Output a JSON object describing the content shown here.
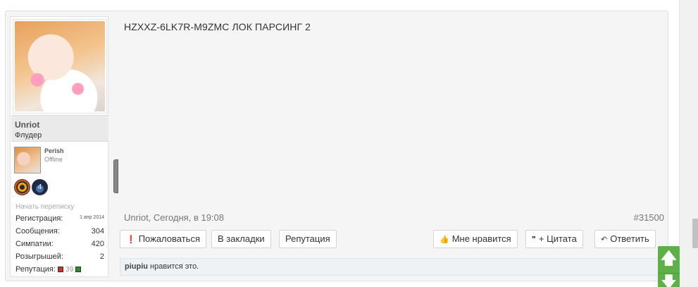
{
  "post": {
    "message": "HZXXZ-6LK7R-M9ZMC ЛОК ПАРСИНГ 2",
    "author_meta": "Unriot, Сегодня, в 19:08",
    "post_id": "#31500"
  },
  "user": {
    "name": "Unriot",
    "title": "Флудер",
    "related_user": {
      "name": "Perish",
      "status": "Offline"
    },
    "pm_link": "Начать переписку",
    "stats": {
      "registration_label": "Регистрация:",
      "registration_value": "1 апр 2014",
      "messages_label": "Сообщения:",
      "messages_value": "304",
      "likes_label": "Симпатии:",
      "likes_value": "420",
      "giveaways_label": "Розыгрышей:",
      "giveaways_value": "2",
      "reputation_label": "Репутация:",
      "reputation_value": "39"
    }
  },
  "actions": {
    "report": "Пожаловаться",
    "bookmark": "В закладки",
    "reputation": "Репутация",
    "like": "Мне нравится",
    "quote": "+ Цитата",
    "reply": "Ответить"
  },
  "likes": {
    "user": "piupiu",
    "text": " нравится это."
  },
  "colors": {
    "accent_green": "#5fb04a",
    "reputation_negative": "#c0392b",
    "reputation_positive": "#2e8b2e"
  }
}
